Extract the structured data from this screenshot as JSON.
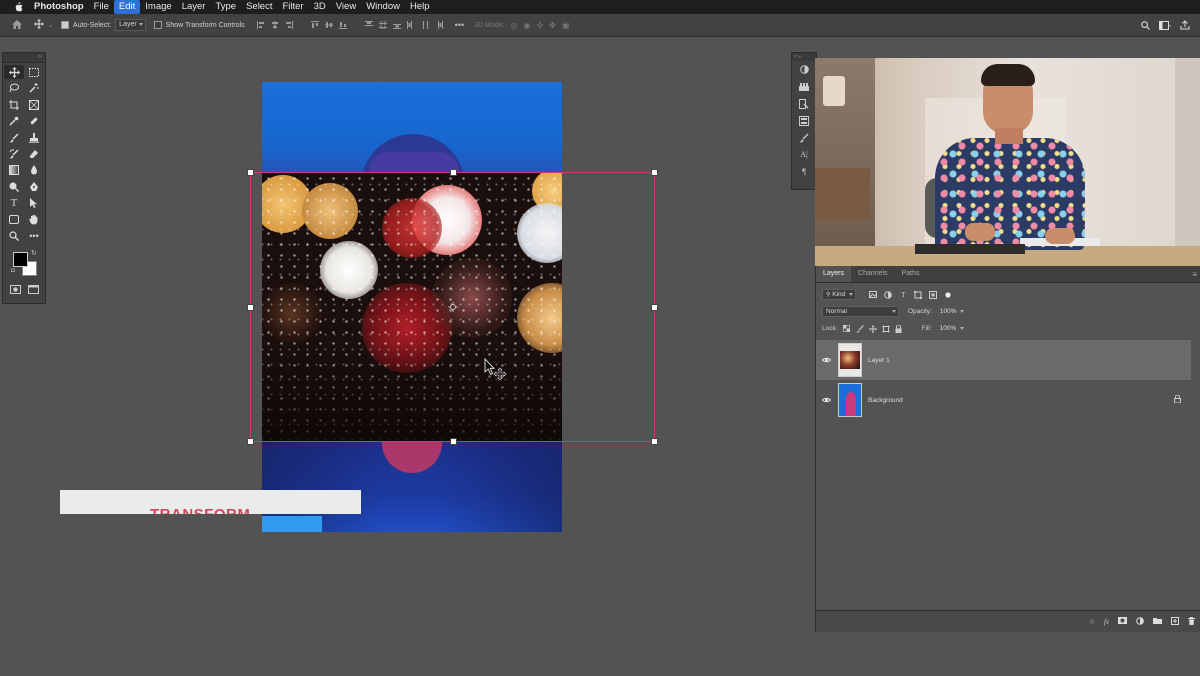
{
  "menubar": {
    "app_name": "Photoshop",
    "items": [
      "File",
      "Edit",
      "Image",
      "Layer",
      "Type",
      "Select",
      "Filter",
      "3D",
      "View",
      "Window",
      "Help"
    ],
    "active_item": "Edit"
  },
  "options_bar": {
    "auto_select_label": "Auto-Select:",
    "auto_select_checked": true,
    "auto_select_target": "Layer",
    "show_transform_label": "Show Transform Controls",
    "show_transform_checked": false,
    "mode_3d_label": "3D Mode:"
  },
  "tools": {
    "icons": [
      "move-icon",
      "marquee-icon",
      "lasso-icon",
      "magic-wand-icon",
      "crop-icon",
      "frame-icon",
      "eyedropper-icon",
      "healing-brush-icon",
      "brush-icon",
      "stamp-icon",
      "history-brush-icon",
      "eraser-icon",
      "gradient-icon",
      "blur-icon",
      "dodge-icon",
      "pen-icon",
      "type-icon",
      "path-select-icon",
      "shape-icon",
      "hand-icon",
      "zoom-icon",
      "more-tools-icon"
    ],
    "foreground_color": "#000000",
    "background_color": "#ffffff"
  },
  "canvas": {
    "overlay_text": "TRANSFORM"
  },
  "layers_panel": {
    "tabs": [
      "Layers",
      "Channels",
      "Paths"
    ],
    "active_tab": "Layers",
    "filter_kind": "Kind",
    "blend_mode": "Normal",
    "opacity_label": "Opacity:",
    "opacity_value": "100%",
    "lock_label": "Lock:",
    "fill_label": "Fill:",
    "fill_value": "100%",
    "layers": [
      {
        "name": "Layer 1",
        "selected": true,
        "visible": true,
        "locked": false
      },
      {
        "name": "Background",
        "selected": false,
        "visible": true,
        "locked": true
      }
    ],
    "footer_icons": [
      "link-layers-icon",
      "fx-icon",
      "add-mask-icon",
      "adjustment-layer-icon",
      "new-group-icon",
      "new-layer-icon",
      "delete-layer-icon"
    ]
  },
  "colors": {
    "accent": "#2f6fd8",
    "transform_box": "#c23b7a",
    "overlay_text": "#d2465a"
  }
}
